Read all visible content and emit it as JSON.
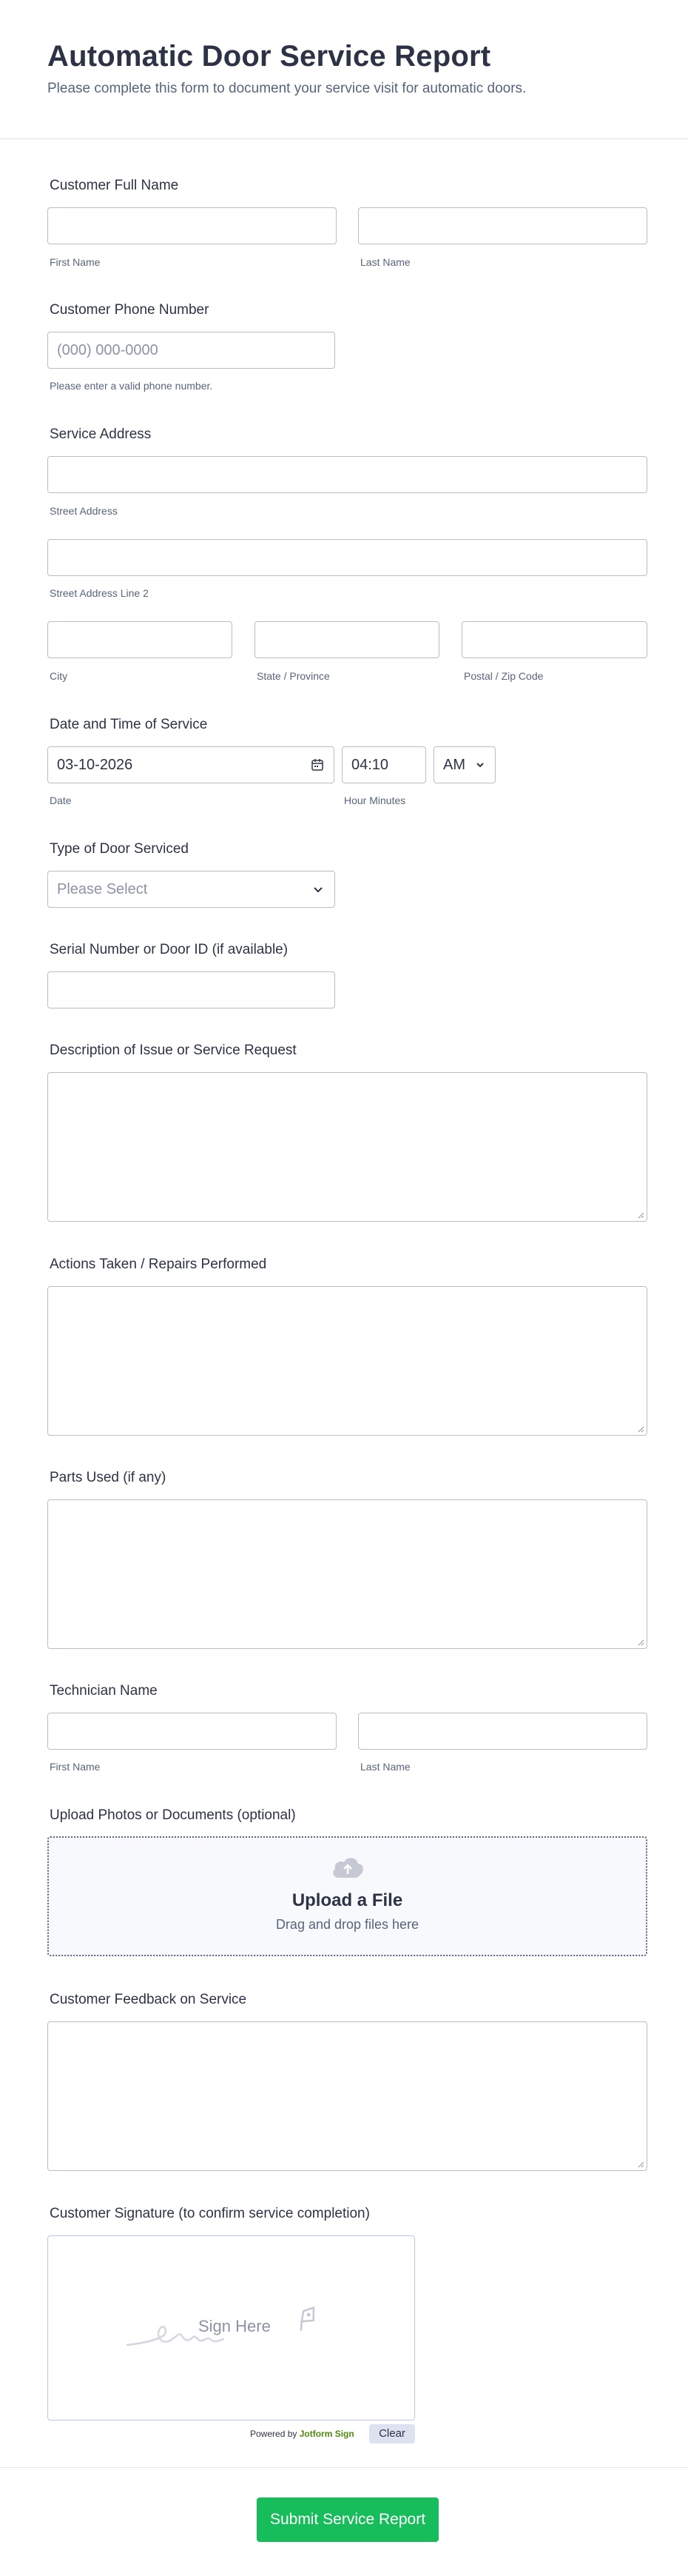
{
  "header": {
    "title": "Automatic Door Service Report",
    "subtitle": "Please complete this form to document your service visit for automatic doors."
  },
  "customer_name": {
    "label": "Customer Full Name",
    "first_sub": "First Name",
    "last_sub": "Last Name"
  },
  "phone": {
    "label": "Customer Phone Number",
    "placeholder": "(000) 000-0000",
    "hint": "Please enter a valid phone number."
  },
  "address": {
    "label": "Service Address",
    "street_sub": "Street Address",
    "street2_sub": "Street Address Line 2",
    "city_sub": "City",
    "state_sub": "State / Province",
    "zip_sub": "Postal / Zip Code"
  },
  "datetime": {
    "label": "Date and Time of Service",
    "date_value": "03-10-2026",
    "time_value": "04:10",
    "ampm_value": "AM",
    "date_sub": "Date",
    "time_sub": "Hour Minutes"
  },
  "door_type": {
    "label": "Type of Door Serviced",
    "placeholder": "Please Select"
  },
  "serial": {
    "label": "Serial Number or Door ID (if available)"
  },
  "description": {
    "label": "Description of Issue or Service Request"
  },
  "actions": {
    "label": "Actions Taken / Repairs Performed"
  },
  "parts": {
    "label": "Parts Used (if any)"
  },
  "technician": {
    "label": "Technician Name",
    "first_sub": "First Name",
    "last_sub": "Last Name"
  },
  "upload": {
    "label": "Upload Photos or Documents (optional)",
    "title": "Upload a File",
    "subtitle": "Drag and drop files here"
  },
  "feedback": {
    "label": "Customer Feedback on Service"
  },
  "signature": {
    "label": "Customer Signature (to confirm service completion)",
    "placeholder": "Sign Here",
    "powered_prefix": "Powered by ",
    "powered_brand": "Jotform Sign",
    "clear_label": "Clear"
  },
  "footer": {
    "submit_label": "Submit Service Report"
  },
  "colors": {
    "submit": "#18bd5b",
    "border": "#b8bdc9",
    "text": "#2c3345",
    "muted": "#57647e"
  }
}
